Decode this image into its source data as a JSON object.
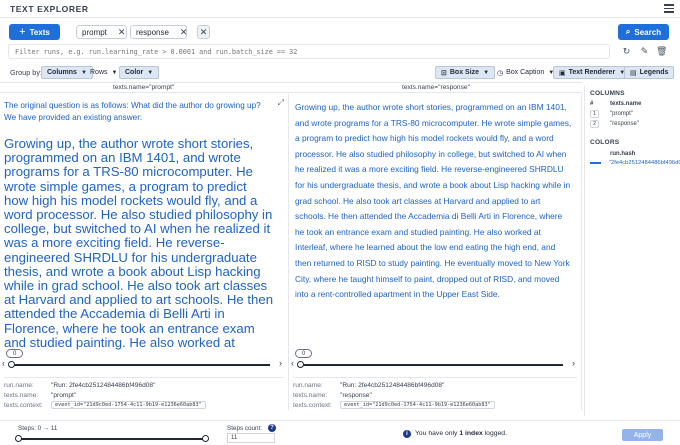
{
  "app": {
    "title": "TEXT EXPLORER"
  },
  "search": {
    "add_label": "Texts",
    "chips": [
      "prompt",
      "response"
    ],
    "search_label": "Search",
    "filter_placeholder": "Filter runs, e.g. run.learning_rate > 0.0001 and run.batch_size == 32"
  },
  "controls": {
    "group_by_label": "Group by:",
    "columns_label": "Columns",
    "rows_label": "Rows",
    "color_label": "Color",
    "box_size_label": "Box Size",
    "box_caption_label": "Box Caption",
    "text_renderer_label": "Text Renderer",
    "legends_label": "Legends"
  },
  "columns": [
    {
      "header": "texts.name=\"prompt\"",
      "intro": "The original question is as follows: What did the author do growing up? We have provided an existing answer:",
      "body": "Growing up, the author wrote short stories, programmed on an IBM 1401, and wrote programs for a TRS-80 microcomputer. He wrote simple games, a program to predict how high his model rockets would fly, and a word processor. He also studied philosophy in college, but switched to AI when he realized it was a more exciting field. He reverse-engineered SHRDLU for his undergraduate thesis, and wrote a book about Lisp hacking while in grad school. He also took art classes at Harvard and applied to art schools. He then attended the Accademia di Belli Arti in Florence, where he took an entrance exam and studied painting. He also worked at Interleaf, where he learned about the low end eating the high end, and then returned to RISD to study painting. He eventually moved to New York",
      "step": "0",
      "run_name_key": "run.name:",
      "run_name": "\"Run: 2fe4cb2512484486bf496d08\"",
      "texts_name_key": "texts.name:",
      "texts_name": "\"prompt\"",
      "context_key": "texts.context:",
      "context": "event_id=\"21d9c0ed-1754-4c11-9b19-e1236e60ab83\""
    },
    {
      "header": "texts.name=\"response\"",
      "body": "Growing up, the author wrote short stories, programmed on an IBM 1401, and wrote programs for a TRS-80 microcomputer. He wrote simple games, a program to predict how high his model rockets would fly, and a word processor. He also studied philosophy in college, but switched to AI when he realized it was a more exciting field. He reverse-engineered SHRDLU for his undergraduate thesis, and wrote a book about Lisp hacking while in grad school. He also took art classes at Harvard and applied to art schools. He then attended the Accademia di Belli Arti in Florence, where he took an entrance exam and studied painting. He also worked at Interleaf, where he learned about the low end eating the high end, and then returned to RISD to study painting. He eventually moved to New York City, where he taught himself to paint, dropped out of RISD, and moved into a rent-controlled apartment in the Upper East Side.",
      "step": "0",
      "run_name_key": "run.name:",
      "run_name": "\"Run: 2fe4cb2512484486bf496d08\"",
      "texts_name_key": "texts.name:",
      "texts_name": "\"response\"",
      "context_key": "texts.context:",
      "context": "event_id=\"21d9c0ed-1754-4c11-9b19-e1236e60ab83\""
    }
  ],
  "sidebar": {
    "columns_title": "COLUMNS",
    "index_head": "#",
    "column_head": "texts.name",
    "rows": [
      {
        "index": "1",
        "value": "\"prompt\""
      },
      {
        "index": "2",
        "value": "\"response\""
      }
    ],
    "colors_title": "COLORS",
    "color_key": "run.hash",
    "color_value": "\"2fe4cb2512484486bf496d08\"",
    "color_hex": "#1e6fd9"
  },
  "footer": {
    "steps_label": "Steps: 0 → 11",
    "steps_count_label": "Steps count:",
    "steps_count_value": "11",
    "notice_pre": "You have only ",
    "notice_bold": "1 index",
    "notice_post": " logged.",
    "apply_label": "Apply"
  }
}
